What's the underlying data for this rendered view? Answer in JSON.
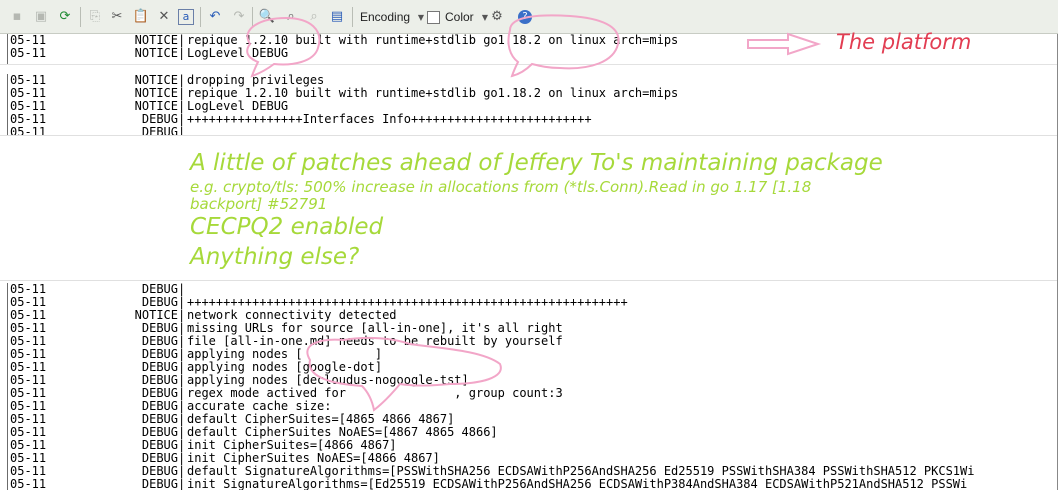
{
  "toolbar": {
    "encoding_label": "Encoding",
    "color_label": "Color",
    "icons": [
      "save-icon",
      "save-all-icon",
      "reload-icon",
      "copy-icon",
      "cut-icon",
      "paste-icon",
      "delete-icon",
      "select-all-icon",
      "undo-icon",
      "redo-icon",
      "find-icon",
      "replace-icon",
      "find-next-icon",
      "view-icon",
      "dropdown-icon",
      "checkbox",
      "dropdown-icon",
      "settings-icon",
      "help-icon"
    ]
  },
  "log_top": [
    {
      "date": "05-11",
      "level": "NOTICE",
      "msg": "repique 1.2.10 built with runtime+stdlib go1.18.2 on linux arch=mips"
    },
    {
      "date": "05-11",
      "level": "NOTICE",
      "msg": "LogLevel DEBUG"
    }
  ],
  "log_mid": [
    {
      "date": "05-11",
      "level": "NOTICE",
      "msg": "dropping privileges"
    },
    {
      "date": "05-11",
      "level": "NOTICE",
      "msg": "repique 1.2.10 built with runtime+stdlib go1.18.2 on linux arch=mips"
    },
    {
      "date": "05-11",
      "level": "NOTICE",
      "msg": "LogLevel DEBUG"
    },
    {
      "date": "05-11",
      "level": "DEBUG",
      "msg": "++++++++++++++++Interfaces Info+++++++++++++++++++++++++"
    },
    {
      "date": "05-11",
      "level": "DEBUG",
      "msg": ""
    }
  ],
  "log_bottom": [
    {
      "date": "05-11",
      "level": "DEBUG",
      "msg": ""
    },
    {
      "date": "05-11",
      "level": "DEBUG",
      "msg": "+++++++++++++++++++++++++++++++++++++++++++++++++++++++++++++"
    },
    {
      "date": "05-11",
      "level": "NOTICE",
      "msg": "network connectivity detected"
    },
    {
      "date": "05-11",
      "level": "DEBUG",
      "msg": "missing URLs for source [all-in-one], it's all right"
    },
    {
      "date": "05-11",
      "level": "DEBUG",
      "msg": "file [all-in-one.md] needs to be rebuilt by yourself"
    },
    {
      "date": "05-11",
      "level": "DEBUG",
      "msg": "applying nodes [          ]"
    },
    {
      "date": "05-11",
      "level": "DEBUG",
      "msg": "applying nodes [google-dot]"
    },
    {
      "date": "05-11",
      "level": "DEBUG",
      "msg": "applying nodes [decloudus-nogoogle-tst]"
    },
    {
      "date": "05-11",
      "level": "DEBUG",
      "msg": "regex mode actived for               , group count:3"
    },
    {
      "date": "05-11",
      "level": "DEBUG",
      "msg": "accurate cache size:"
    },
    {
      "date": "05-11",
      "level": "DEBUG",
      "msg": "default CipherSuites=[4865 4866 4867]"
    },
    {
      "date": "05-11",
      "level": "DEBUG",
      "msg": "default CipherSuites NoAES=[4867 4865 4866]"
    },
    {
      "date": "05-11",
      "level": "DEBUG",
      "msg": "init CipherSuites=[4866 4867]"
    },
    {
      "date": "05-11",
      "level": "DEBUG",
      "msg": "init CipherSuites NoAES=[4866 4867]"
    },
    {
      "date": "05-11",
      "level": "DEBUG",
      "msg": "default SignatureAlgorithms=[PSSWithSHA256 ECDSAWithP256AndSHA256 Ed25519 PSSWithSHA384 PSSWithSHA512 PKCS1Wi"
    },
    {
      "date": "05-11",
      "level": "DEBUG",
      "msg": "init SignatureAlgorithms=[Ed25519 ECDSAWithP256AndSHA256 ECDSAWithP384AndSHA384 ECDSAWithP521AndSHA512 PSSWi"
    }
  ],
  "annotations": {
    "platform": "The platform",
    "patches_title": "A little of patches ahead of Jeffery To's maintaining package",
    "patches_example_1": "e.g. crypto/tls: 500% increase in allocations from (*tls.Conn).Read in go 1.17 [1.18",
    "patches_example_2": "backport] #52791",
    "cecpq2": "CECPQ2 enabled",
    "anything_else": "Anything else?"
  },
  "colors": {
    "annotation_green": "#a6d93a",
    "annotation_red": "#e23d52",
    "highlight_pink": "#f2a6c8"
  }
}
